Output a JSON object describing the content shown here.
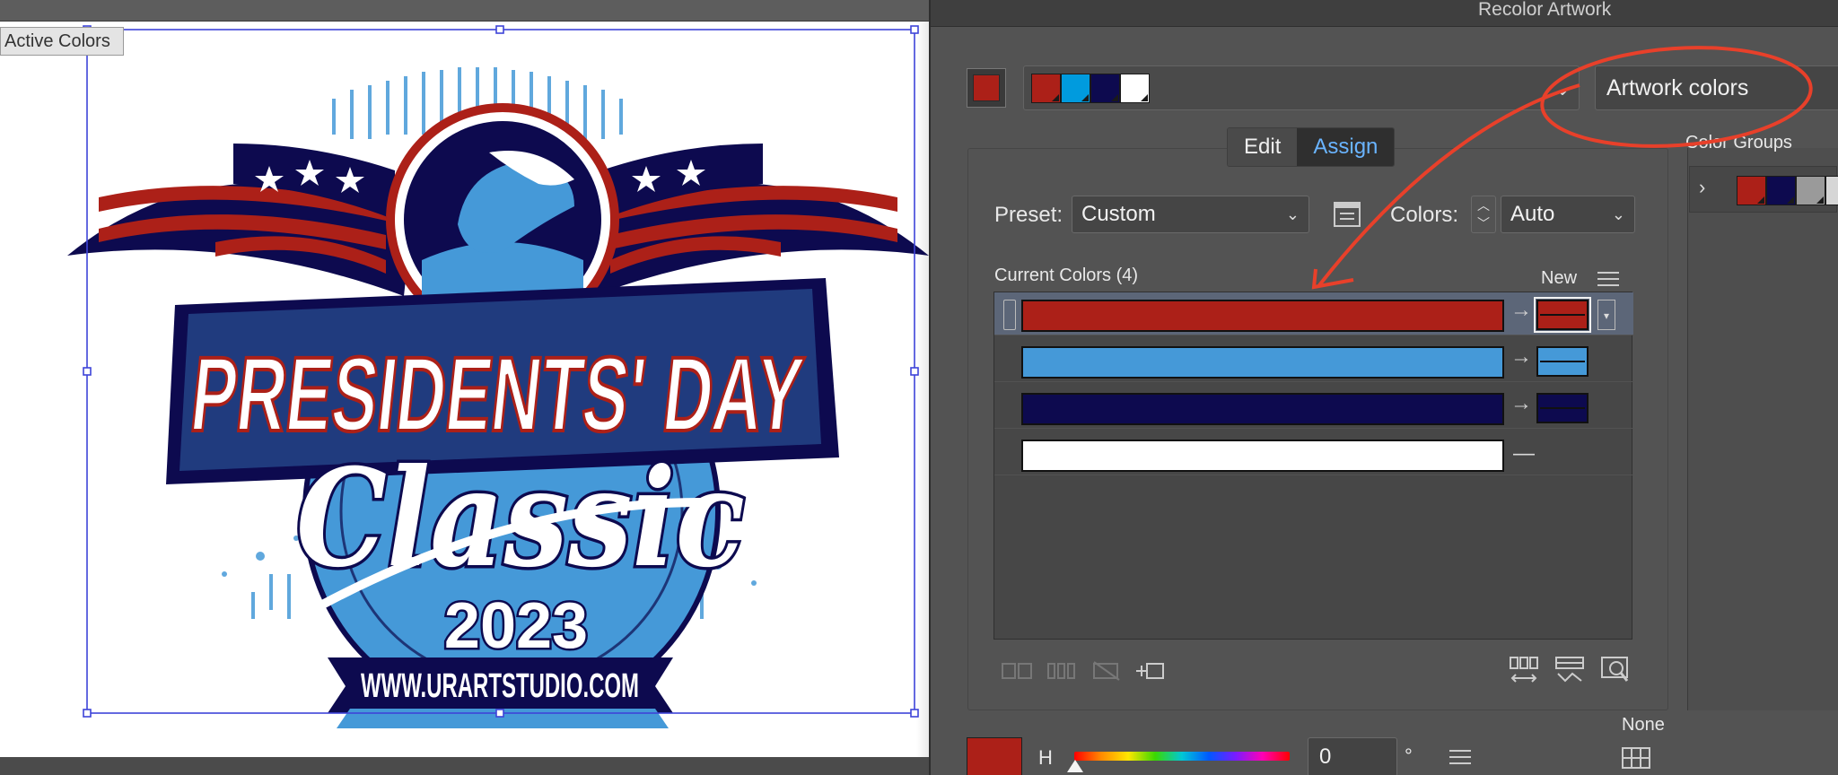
{
  "canvas": {
    "active_colors_label": "Active Colors",
    "artwork": {
      "title_line1": "PRESIDENTS' DAY",
      "title_line2": "Classic",
      "year": "2023",
      "website": "WWW.URARTSTUDIO.COM"
    }
  },
  "panel": {
    "title": "Recolor Artwork",
    "artwork_colors": "Artwork colors",
    "tabs": [
      {
        "label": "Edit",
        "active": false
      },
      {
        "label": "Assign",
        "active": true
      }
    ],
    "preset_label": "Preset:",
    "preset_value": "Custom",
    "colors_label": "Colors:",
    "colors_value": "Auto",
    "current_colors_label": "Current Colors (4)",
    "new_label": "New",
    "color_groups_label": "Color Groups",
    "none_label": "None",
    "hue_label": "H",
    "hue_value": "0",
    "hue_unit": "°",
    "harmony_colors": [
      "#ac2018",
      "#009bde",
      "#0d0a4f",
      "#ffffff"
    ],
    "group_colors": [
      "#ac2018",
      "#0d0a4f",
      "#9a9a9a",
      "#d6d6d6"
    ],
    "rows": [
      {
        "current": "#ac2018",
        "new": "#ac2018",
        "mapped": true,
        "selected": true
      },
      {
        "current": "#4599d8",
        "new": "#4599d8",
        "mapped": true,
        "selected": false
      },
      {
        "current": "#0d0a4f",
        "new": "#0d0a4f",
        "mapped": true,
        "selected": false
      },
      {
        "current": "#ffffff",
        "new": null,
        "mapped": false,
        "selected": false
      }
    ]
  },
  "annotation_color": "#e8402a"
}
